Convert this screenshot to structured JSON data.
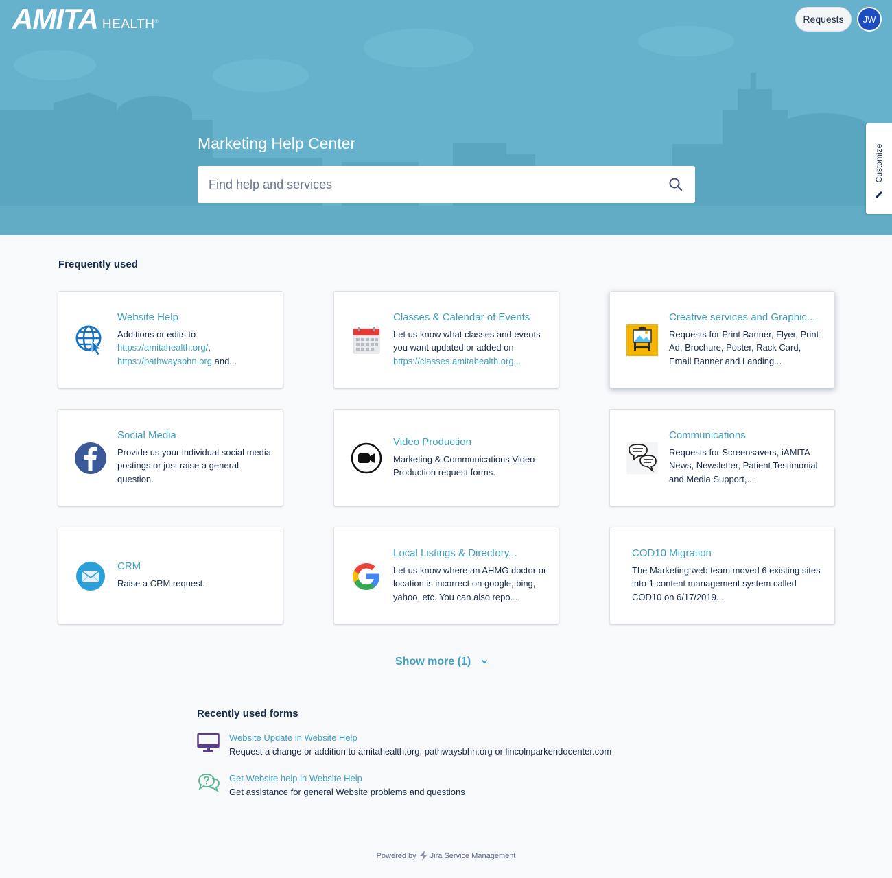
{
  "header": {
    "logo_main": "AMITA",
    "logo_sub": "HEALTH",
    "requests_label": "Requests",
    "avatar_initials": "JW",
    "customize_label": "Customize",
    "hero_title": "Marketing Help Center",
    "search_placeholder": "Find help and services",
    "colors": {
      "banner": "#66b2cc",
      "skyline": "#5aa6c0",
      "link": "#3f9fbe"
    }
  },
  "frequently_used": {
    "title": "Frequently used",
    "cards": [
      {
        "title": "Website Help",
        "icon": "globe-cursor-icon",
        "desc_prefix": "Additions or edits to ",
        "link1": "https://amitahealth.org/",
        "mid": ", ",
        "link2": "https://pathwaysbhn.org",
        "desc_suffix": " and..."
      },
      {
        "title": "Classes & Calendar of Events",
        "icon": "calendar-icon",
        "desc_prefix": "Let us know what classes and events you want updated or added on ",
        "link1": "https://classes.amitahealth.org...",
        "desc_suffix": ""
      },
      {
        "title": "Creative services and Graphic...",
        "icon": "easel-image-icon",
        "desc": "Requests for Print Banner, Flyer, Print Ad, Brochure, Poster, Rack Card, Email Banner and Landing..."
      },
      {
        "title": "Social Media",
        "icon": "facebook-icon",
        "desc": "Provide us your individual social media postings or just raise a general question."
      },
      {
        "title": "Video Production",
        "icon": "video-camera-icon",
        "desc": "Marketing & Communications Video Production request forms."
      },
      {
        "title": "Communications",
        "icon": "chat-bubbles-icon",
        "desc": "Requests for Screensavers, iAMITA News, Newsletter, Patient Testimonial and Media Support,..."
      },
      {
        "title": "CRM",
        "icon": "envelope-icon",
        "desc": "Raise a CRM request."
      },
      {
        "title": "Local Listings & Directory...",
        "icon": "google-icon",
        "desc": "Let us know where an AHMG doctor or location is incorrect on google, bing, yahoo, etc. You can also repo..."
      },
      {
        "title": "COD10 Migration",
        "desc": "The Marketing web team moved 6 existing sites into 1 content management system called COD10 on 6/17/2019..."
      }
    ],
    "show_more": "Show more (1)"
  },
  "recent_forms": {
    "title": "Recently used forms",
    "items": [
      {
        "title": "Website Update in Website Help",
        "desc": "Request a change or addition to amitahealth.org, pathwaysbhn.org or lincolnparkendocenter.com",
        "icon": "monitor-icon"
      },
      {
        "title": "Get Website help in Website Help",
        "desc": "Get assistance for general Website problems and questions",
        "icon": "question-chat-icon"
      }
    ]
  },
  "footer": {
    "powered_by": "Powered by",
    "product": "Jira Service Management"
  }
}
